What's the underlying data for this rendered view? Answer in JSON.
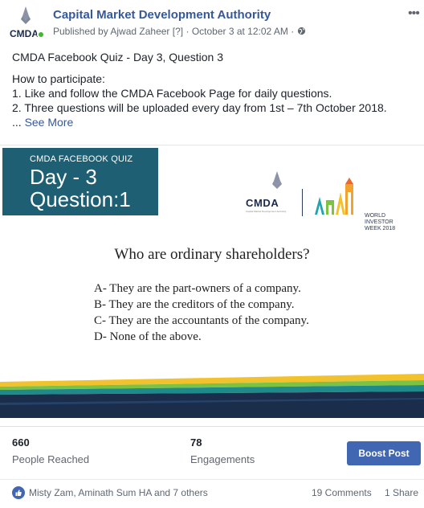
{
  "header": {
    "page_name": "Capital Market Development Authority",
    "avatar_text": "CMDA",
    "publisher": "Published by Ajwad Zaheer",
    "help_marker": "[?]",
    "separator": "·",
    "timestamp": "October 3 at 12:02 AM",
    "menu_icon": "more-dots-icon",
    "privacy_icon": "globe-icon"
  },
  "post": {
    "title": "CMDA Facebook Quiz - Day 3, Question 3",
    "lines": [
      "How to participate:",
      "1. Like and follow the CMDA Facebook Page for daily questions.",
      "2. Three questions will be uploaded every day from 1st – 7th October 2018."
    ],
    "ellipsis": "...",
    "see_more": "See More"
  },
  "image": {
    "quiz_label": "CMDA FACEBOOK QUIZ",
    "day": "Day - 3",
    "question_number": "Question:1",
    "logo_text": "CMDA",
    "logo_subtitle": "Capital Market Development Authority",
    "wiw_line1": "WORLD",
    "wiw_line2": "INVESTOR",
    "wiw_line3": "WEEK 2018",
    "question": "Who are ordinary shareholders?",
    "answers": [
      "A- They are the part-owners of a company.",
      "B- They are the creditors of the company.",
      "C- They are the accountants of the company.",
      "D- None of the above."
    ],
    "colors": {
      "day_box": "#1e5f73",
      "stripe_navy": "#1a2d4a",
      "stripe_teal": "#1e8a8a",
      "stripe_green": "#7ec242",
      "stripe_yellow": "#f2c12e"
    }
  },
  "stats": {
    "reached_value": "660",
    "reached_label": "People Reached",
    "engagements_value": "78",
    "engagements_label": "Engagements",
    "boost_label": "Boost Post"
  },
  "footer": {
    "likers": "Misty Zam, Aminath Sum HA and 7 others",
    "comments": "19 Comments",
    "shares": "1 Share"
  }
}
